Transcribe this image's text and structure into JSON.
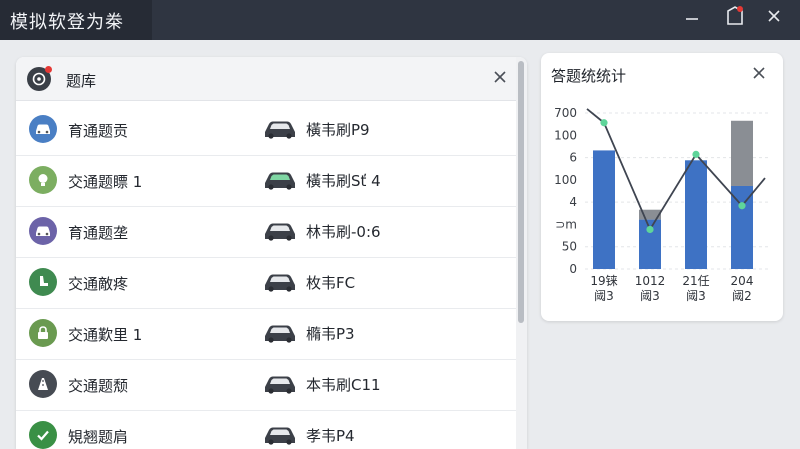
{
  "window": {
    "title": "模拟软登为桊"
  },
  "panel": {
    "title": "题库",
    "rows": [
      {
        "left": "育通题贡",
        "right": "橫韦刷P9",
        "icon": "car-icon",
        "color": "#4a7fc4"
      },
      {
        "left": "交通题瞟 1",
        "right": "橫韦刷Sť 4",
        "icon": "bulb-icon",
        "color": "#7cae61"
      },
      {
        "left": "育通题垄",
        "right": "林韦刷-0:6",
        "icon": "car-icon",
        "color": "#6c63a8"
      },
      {
        "left": "交通敵疼",
        "right": "枚韦FC",
        "icon": "seat-icon",
        "color": "#3f8a50"
      },
      {
        "left": "交通歎里 1",
        "right": "橢韦P3",
        "icon": "lock-icon",
        "color": "#6a9a50"
      },
      {
        "left": "交通题颓",
        "right": "本韦刷C11",
        "icon": "road-icon",
        "color": "#464b53"
      },
      {
        "left": "䂓翘题肩",
        "right": "孝韦P4",
        "icon": "check-icon",
        "color": "#3a9045"
      }
    ]
  },
  "stats": {
    "title": "答题统统计"
  },
  "chart_data": {
    "type": "bar",
    "title": "答题统统计",
    "categories": [
      "19铼 阈3",
      "1012 阈3",
      "21任 阈3",
      "204 阈2"
    ],
    "tick_labels": [
      "700",
      "100",
      "6",
      "100",
      "4",
      "⊃m",
      "50",
      "0"
    ],
    "series": [
      {
        "values": [
          6,
          2.5,
          5.5,
          4.2
        ],
        "color": "#3e72c4"
      },
      {
        "values": [
          0,
          0.5,
          0,
          3.3
        ],
        "color": "#8a8e94"
      }
    ],
    "line": [
      7.4,
      2.0,
      5.8,
      3.2
    ],
    "ylim": [
      0,
      8.5
    ],
    "colors": {
      "line": "#3f4551",
      "marker": "#5fd59a"
    }
  }
}
